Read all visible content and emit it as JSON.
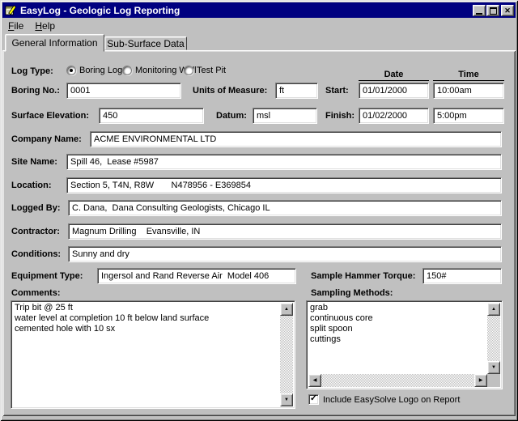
{
  "window": {
    "title": "EasyLog - Geologic Log Reporting"
  },
  "icons": {
    "scroll_up": "▲",
    "scroll_down": "▼",
    "scroll_left": "◀",
    "scroll_right": "▶",
    "close": "✕",
    "check": "✓"
  },
  "menu": {
    "items": [
      {
        "label": "File",
        "accel": "F",
        "rest": "ile"
      },
      {
        "label": "Help",
        "accel": "H",
        "rest": "elp"
      }
    ]
  },
  "tabs": [
    {
      "label": "General Information",
      "active": true
    },
    {
      "label": "Sub-Surface Data",
      "active": false
    }
  ],
  "form": {
    "log_type": {
      "label": "Log Type:",
      "options": [
        {
          "label": "Boring Log",
          "selected": true
        },
        {
          "label": "Monitoring Well",
          "selected": false
        },
        {
          "label": "Test Pit",
          "selected": false
        }
      ]
    },
    "column_headers": {
      "date": "Date",
      "time": "Time"
    },
    "boring_no": {
      "label": "Boring No.:",
      "value": "0001"
    },
    "units_of_measure": {
      "label": "Units of Measure:",
      "value": "ft"
    },
    "start": {
      "label": "Start:",
      "date": "01/01/2000",
      "time": "10:00am"
    },
    "surface_elevation": {
      "label": "Surface Elevation:",
      "value": "450"
    },
    "datum": {
      "label": "Datum:",
      "value": "msl"
    },
    "finish": {
      "label": "Finish:",
      "date": "01/02/2000",
      "time": "5:00pm"
    },
    "company_name": {
      "label": "Company Name:",
      "value": "ACME ENVIRONMENTAL LTD"
    },
    "site_name": {
      "label": "Site Name:",
      "value": "Spill 46,  Lease #5987"
    },
    "location": {
      "label": "Location:",
      "value": "Section 5, T4N, R8W       N478956 - E369854"
    },
    "logged_by": {
      "label": "Logged By:",
      "value": "C. Dana,  Dana Consulting Geologists, Chicago IL"
    },
    "contractor": {
      "label": "Contractor:",
      "value": "Magnum Drilling    Evansville, IN"
    },
    "conditions": {
      "label": "Conditions:",
      "value": "Sunny and dry"
    },
    "equipment_type": {
      "label": "Equipment Type:",
      "value": "Ingersol and Rand Reverse Air  Model 406"
    },
    "sample_hammer_torque": {
      "label": "Sample Hammer Torque:",
      "value": "150#"
    },
    "comments": {
      "label": "Comments:",
      "value": "Trip bit @ 25 ft\nwater level at completion 10 ft below land surface\ncemented hole with 10 sx"
    },
    "sampling_methods": {
      "label": "Sampling Methods:",
      "items": [
        "grab",
        "continuous core",
        "split spoon",
        "cuttings"
      ]
    },
    "logo_checkbox": {
      "label": "Include EasySolve Logo on Report",
      "checked": true
    }
  },
  "colors": {
    "titlebar": "#000080",
    "titlebar_text": "#ffffff",
    "chrome": "#c0c0c0",
    "field_background": "#ffffff",
    "text": "#000000"
  }
}
